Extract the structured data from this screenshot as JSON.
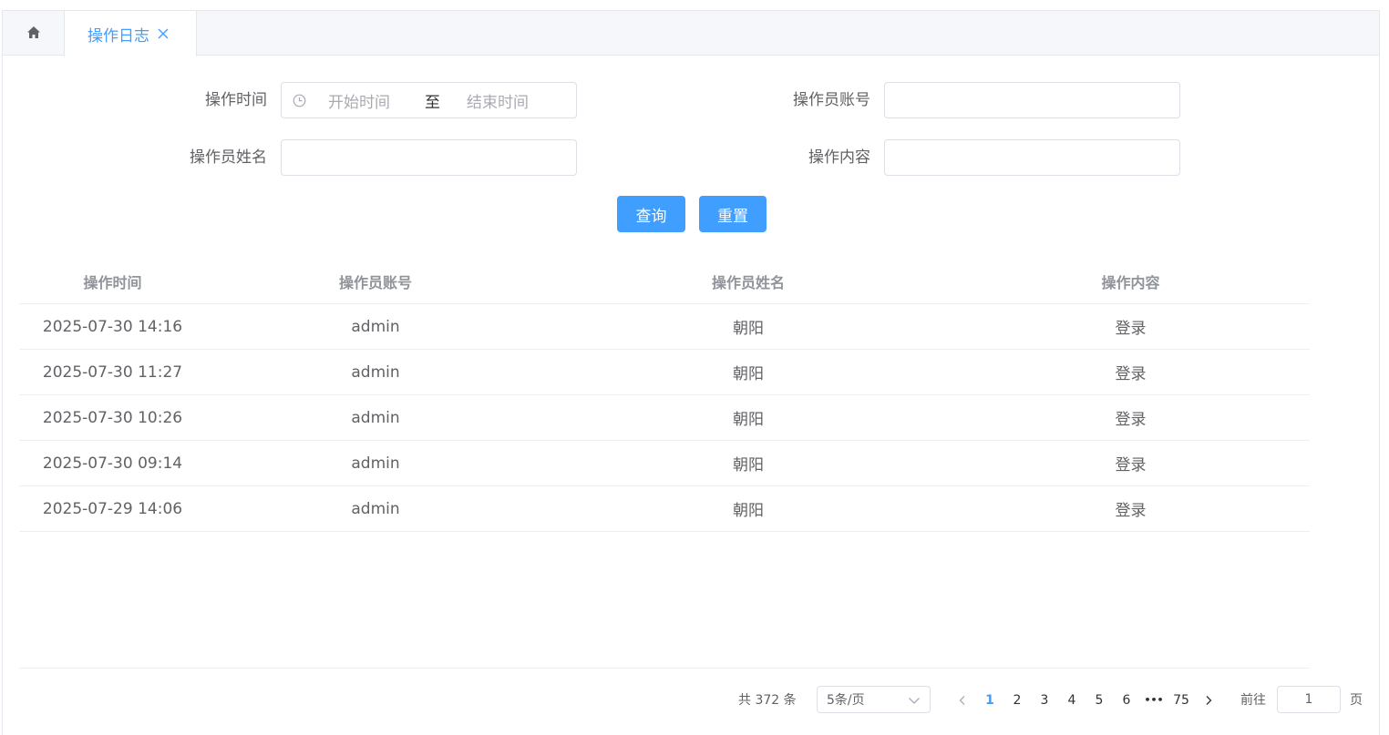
{
  "tabs": {
    "home_icon": "home-icon",
    "active_label": "操作日志"
  },
  "form": {
    "time_label": "操作时间",
    "start_placeholder": "开始时间",
    "range_separator": "至",
    "end_placeholder": "结束时间",
    "account_label": "操作员账号",
    "account_value": "",
    "name_label": "操作员姓名",
    "name_value": "",
    "content_label": "操作内容",
    "content_value": "",
    "search_button": "查询",
    "reset_button": "重置"
  },
  "table": {
    "columns": [
      "操作时间",
      "操作员账号",
      "操作员姓名",
      "操作内容"
    ],
    "rows": [
      [
        "2025-07-30 14:16",
        "admin",
        "朝阳",
        "登录"
      ],
      [
        "2025-07-30 11:27",
        "admin",
        "朝阳",
        "登录"
      ],
      [
        "2025-07-30 10:26",
        "admin",
        "朝阳",
        "登录"
      ],
      [
        "2025-07-30 09:14",
        "admin",
        "朝阳",
        "登录"
      ],
      [
        "2025-07-29 14:06",
        "admin",
        "朝阳",
        "登录"
      ]
    ]
  },
  "pagination": {
    "total_text": "共 372 条",
    "page_size": "5条/页",
    "pages": [
      "1",
      "2",
      "3",
      "4",
      "5",
      "6"
    ],
    "ellipsis": "•••",
    "last_page": "75",
    "current_page": "1",
    "goto_label": "前往",
    "goto_value": "1",
    "goto_suffix": "页"
  },
  "colors": {
    "accent": "#409eff",
    "border": "#dcdfe6",
    "text": "#606266",
    "header_text": "#909399"
  }
}
